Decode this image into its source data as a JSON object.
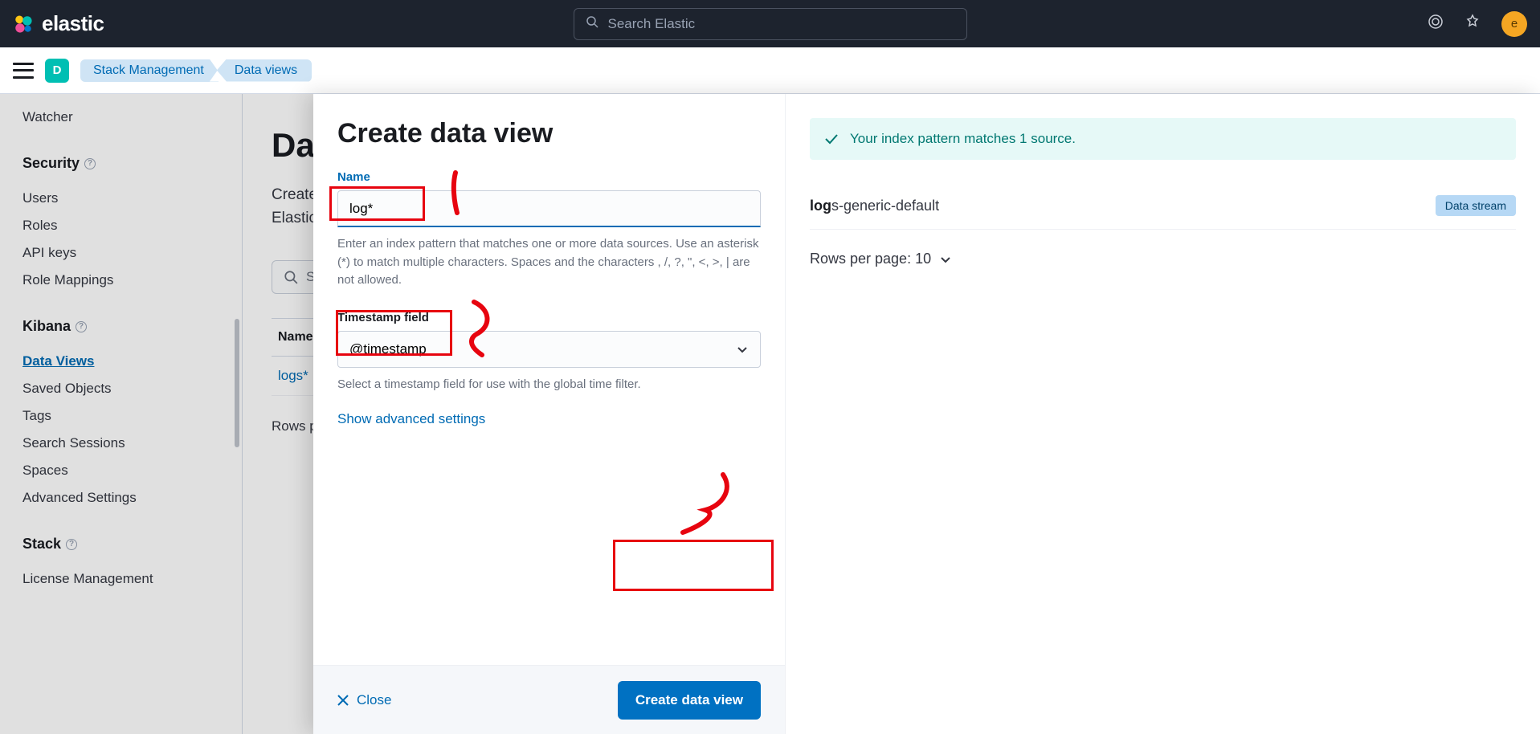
{
  "header": {
    "brand": "elastic",
    "search_placeholder": "Search Elastic",
    "avatar_letter": "e",
    "space_letter": "D"
  },
  "breadcrumbs": [
    {
      "label": "Stack Management"
    },
    {
      "label": "Data views"
    }
  ],
  "sidebar": {
    "items_top": [
      "Watcher"
    ],
    "groups": [
      {
        "title": "Security",
        "items": [
          "Users",
          "Roles",
          "API keys",
          "Role Mappings"
        ]
      },
      {
        "title": "Kibana",
        "items": [
          "Data Views",
          "Saved Objects",
          "Tags",
          "Search Sessions",
          "Spaces",
          "Advanced Settings"
        ],
        "active": "Data Views"
      },
      {
        "title": "Stack",
        "items": [
          "License Management"
        ]
      }
    ]
  },
  "background": {
    "title_prefix": "Da",
    "subtitle_line1": "Create",
    "subtitle_line2": "Elastic",
    "search_placeholder_short": "S",
    "table": {
      "header": "Name",
      "row": "logs*"
    },
    "rows_prefix": "Rows p"
  },
  "flyout": {
    "title": "Create data view",
    "form": {
      "name_label": "Name",
      "name_value": "log*",
      "name_help": "Enter an index pattern that matches one or more data sources. Use an asterisk (*) to match multiple characters. Spaces and the characters , /, ?, \", <, >, | are not allowed.",
      "timestamp_label": "Timestamp field",
      "timestamp_value": "@timestamp",
      "timestamp_help": "Select a timestamp field for use with the global time filter.",
      "advanced_link": "Show advanced settings"
    },
    "footer": {
      "close": "Close",
      "create": "Create data view"
    },
    "side": {
      "callout": "Your index pattern matches 1 source.",
      "source_bold": "log",
      "source_rest": "s-generic-default",
      "badge": "Data stream",
      "rows_label": "Rows per page: 10"
    }
  }
}
